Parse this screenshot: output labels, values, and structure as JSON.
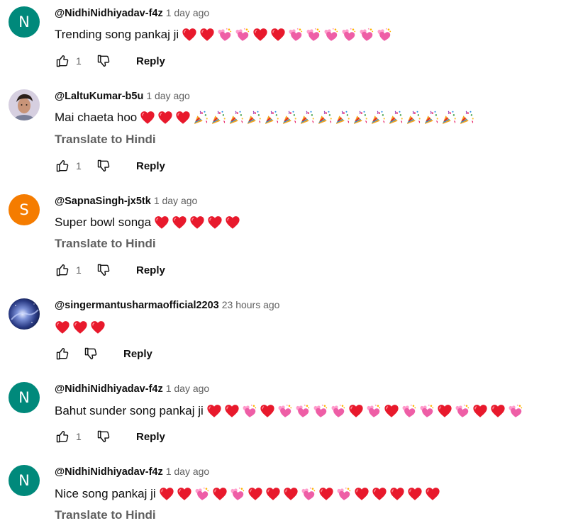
{
  "reply_label": "Reply",
  "translate_label": "Translate to Hindi",
  "colors": {
    "heart": "#e8192c",
    "sparkle_heart": "#f06aa8",
    "teal_avatar": "#00897b",
    "orange_avatar": "#f57c00",
    "secondary_text": "#606060"
  },
  "comments": [
    {
      "author": "@NidhiNidhiyadav-f4z",
      "time": "1 day ago",
      "avatar_letter": "N",
      "text": "Trending song pankaj ji",
      "likes": "1"
    },
    {
      "author": "@LaltuKumar-b5u",
      "time": "1 day ago",
      "avatar_letter": "",
      "text": "Mai chaeta hoo",
      "likes": "1"
    },
    {
      "author": "@SapnaSingh-jx5tk",
      "time": "1 day ago",
      "avatar_letter": "S",
      "text": "Super bowl songa",
      "likes": "1"
    },
    {
      "author": "@singermantusharmaofficial2203",
      "time": "23 hours ago",
      "avatar_letter": "",
      "text": "",
      "likes": ""
    },
    {
      "author": "@NidhiNidhiyadav-f4z",
      "time": "1 day ago",
      "avatar_letter": "N",
      "text": "Bahut sunder song pankaj ji",
      "likes": "1"
    },
    {
      "author": "@NidhiNidhiyadav-f4z",
      "time": "1 day ago",
      "avatar_letter": "N",
      "text": "Nice song pankaj ji",
      "likes": ""
    }
  ]
}
